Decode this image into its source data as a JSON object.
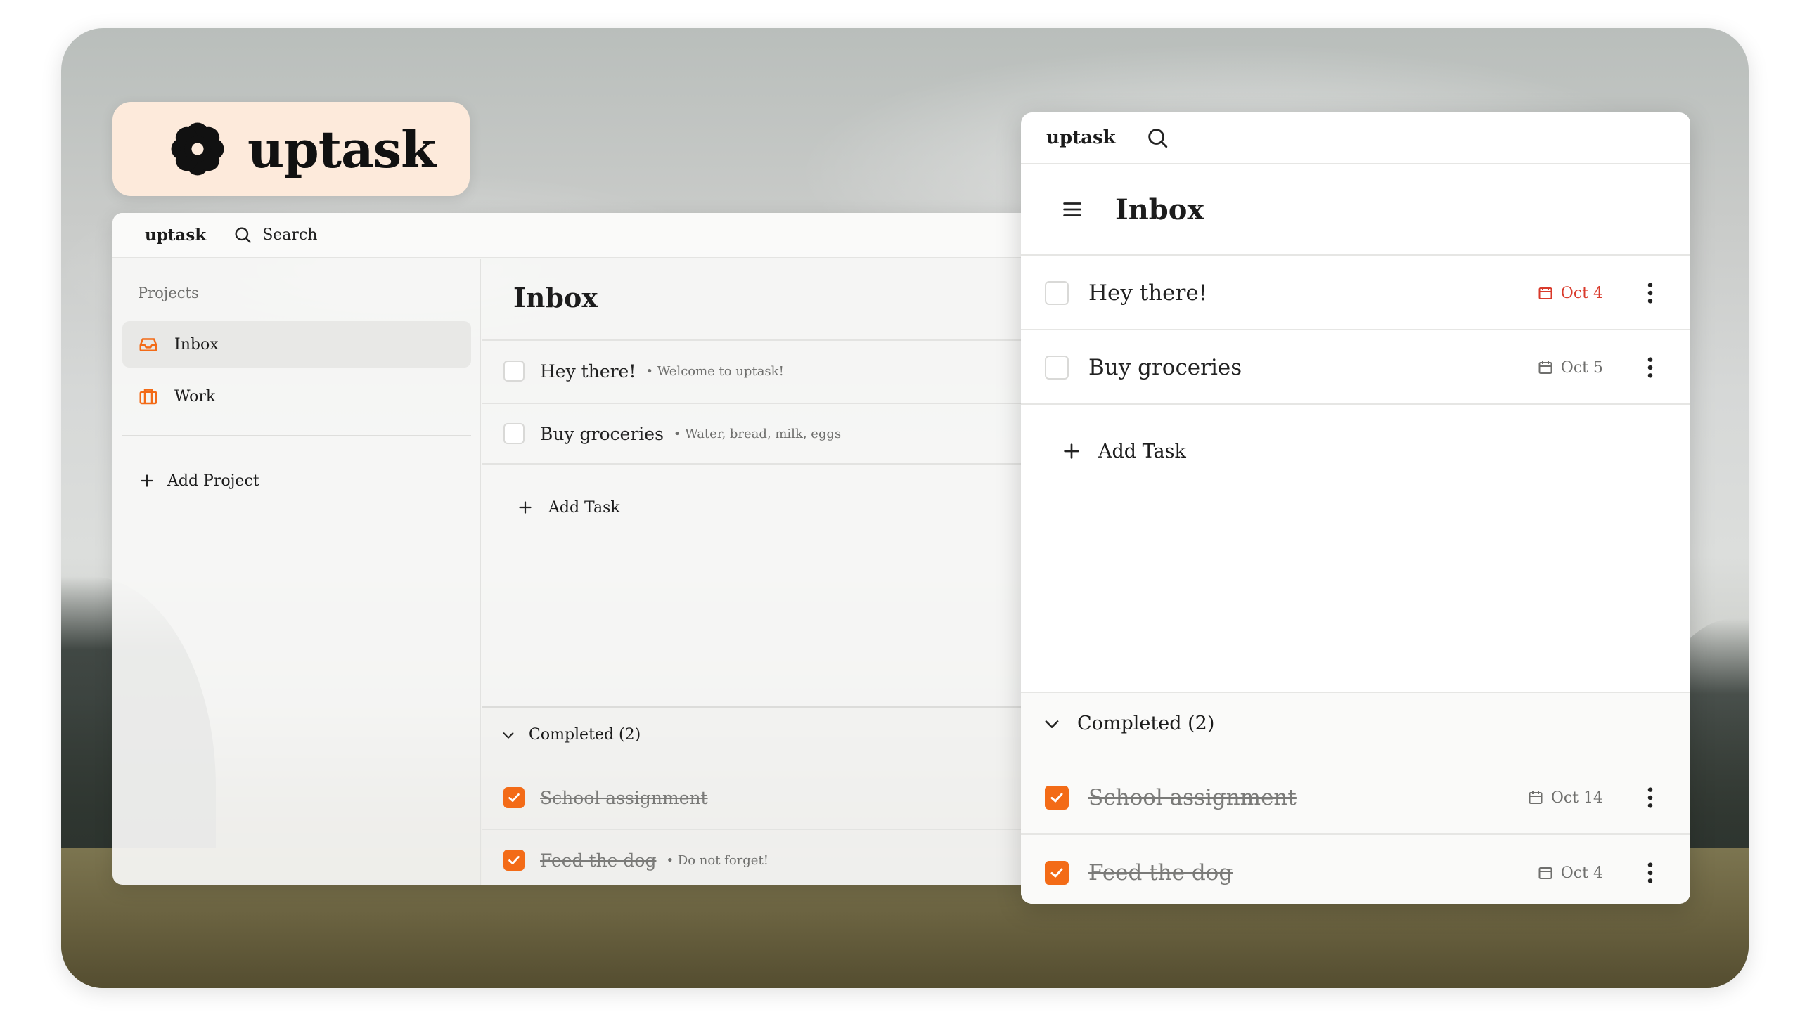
{
  "brand": {
    "name": "uptask",
    "accent_color": "#f36b17",
    "logo_icon": "flower-icon"
  },
  "desktop": {
    "topbar": {
      "brand": "uptask",
      "search_label": "Search"
    },
    "sidebar": {
      "section_label": "Projects",
      "items": [
        {
          "label": "Inbox",
          "icon": "inbox-icon",
          "active": true
        },
        {
          "label": "Work",
          "icon": "briefcase-icon",
          "active": false
        }
      ],
      "add_project": "Add Project"
    },
    "main": {
      "title": "Inbox",
      "tasks": [
        {
          "name": "Hey there!",
          "note": "• Welcome to uptask!",
          "done": false
        },
        {
          "name": "Buy groceries",
          "note": "• Water, bread, milk, eggs",
          "done": false
        }
      ],
      "add_task": "Add Task",
      "completed_label": "Completed (2)",
      "completed_tasks": [
        {
          "name": "School assignment",
          "note": "",
          "done": true
        },
        {
          "name": "Feed the dog",
          "note": "• Do not forget!",
          "done": true
        }
      ]
    }
  },
  "mobile": {
    "topbar": {
      "brand": "uptask"
    },
    "title": "Inbox",
    "tasks": [
      {
        "name": "Hey there!",
        "date": "Oct 4",
        "overdue": true,
        "done": false
      },
      {
        "name": "Buy groceries",
        "date": "Oct 5",
        "overdue": false,
        "done": false
      }
    ],
    "add_task": "Add Task",
    "completed_label": "Completed (2)",
    "completed_tasks": [
      {
        "name": "School assignment",
        "date": "Oct 14",
        "done": true
      },
      {
        "name": "Feed the dog",
        "date": "Oct 4",
        "done": true
      }
    ],
    "overdue_color": "#d93a2b"
  }
}
